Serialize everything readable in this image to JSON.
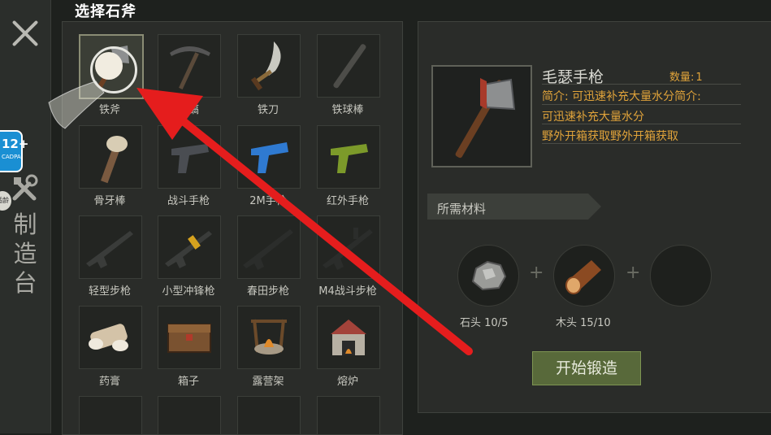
{
  "section_title": "选择石斧",
  "sidebar": {
    "title_chars": [
      "制",
      "造",
      "台"
    ],
    "age_badge": {
      "number": "12+",
      "sub": "CADPA"
    },
    "side_badge": "适龄"
  },
  "items": [
    {
      "label": "铁斧",
      "icon": "axe-icon",
      "selected": true
    },
    {
      "label": "石镐",
      "icon": "pickaxe-icon"
    },
    {
      "label": "铁刀",
      "icon": "sword-icon"
    },
    {
      "label": "铁球棒",
      "icon": "bat-icon"
    },
    {
      "label": "骨牙棒",
      "icon": "bone-club-icon"
    },
    {
      "label": "战斗手枪",
      "icon": "pistol-icon"
    },
    {
      "label": "2M手枪",
      "icon": "pistol-blue-icon"
    },
    {
      "label": "红外手枪",
      "icon": "pistol-yellow-icon"
    },
    {
      "label": "轻型步枪",
      "icon": "rifle-icon"
    },
    {
      "label": "小型冲锋枪",
      "icon": "smg-icon"
    },
    {
      "label": "春田步枪",
      "icon": "rifle-black-icon"
    },
    {
      "label": "M4战斗步枪",
      "icon": "m4-icon"
    },
    {
      "label": "药膏",
      "icon": "bandage-icon"
    },
    {
      "label": "箱子",
      "icon": "chest-icon"
    },
    {
      "label": "露营架",
      "icon": "campfire-icon"
    },
    {
      "label": "熔炉",
      "icon": "furnace-icon"
    }
  ],
  "detail": {
    "name": "毛瑟手枪",
    "quantity_label": "数量:",
    "quantity_value": "1",
    "desc_lines": [
      "简介: 可迅速补充大量水分简介:",
      "可迅速补充大量水分",
      "野外开箱获取野外开箱获取"
    ]
  },
  "materials": {
    "title": "所需材料",
    "list": [
      {
        "name": "石头",
        "have": "10/5",
        "icon": "stone-icon"
      },
      {
        "name": "木头",
        "have": "15/10",
        "icon": "wood-log-icon"
      }
    ],
    "plus": "+"
  },
  "forge_button": "开始锻造",
  "colors": {
    "accent_orange": "#e0a33a",
    "button_green": "#58693a",
    "arrow_red": "#e51d1d"
  }
}
